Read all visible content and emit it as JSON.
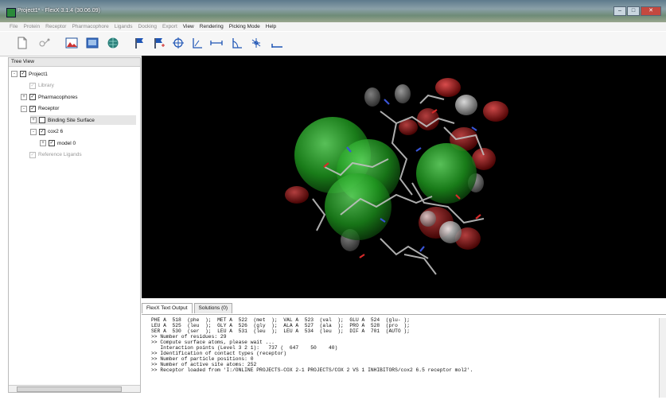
{
  "window": {
    "title": "Project1* - FlexX 3.1.4  (30.06.09)"
  },
  "menu": [
    {
      "label": "File",
      "enabled": false
    },
    {
      "label": "Protein",
      "enabled": false
    },
    {
      "label": "Receptor",
      "enabled": false
    },
    {
      "label": "Pharmacophore",
      "enabled": false
    },
    {
      "label": "Ligands",
      "enabled": false
    },
    {
      "label": "Docking",
      "enabled": false
    },
    {
      "label": "Export",
      "enabled": false
    },
    {
      "label": "View",
      "enabled": true
    },
    {
      "label": "Rendering",
      "enabled": true
    },
    {
      "label": "Picking Mode",
      "enabled": true
    },
    {
      "label": "Help",
      "enabled": true
    }
  ],
  "toolbar_icons": [
    "new-file-icon",
    "ligand-icon",
    "mountain-icon",
    "image-icon",
    "globe-icon",
    "flag-icon",
    "flag-plus-icon",
    "crosshair-icon",
    "axes-icon",
    "distance-icon",
    "angle-icon",
    "dihedral-icon",
    "measure-icon"
  ],
  "tree": {
    "title": "Tree View",
    "items": [
      {
        "label": "Project1",
        "checked": true,
        "expander": "-",
        "dim": false
      },
      {
        "label": "Library",
        "checked": true,
        "expander": "",
        "dim": true
      },
      {
        "label": "Pharmacophores",
        "checked": true,
        "expander": "+",
        "dim": false
      },
      {
        "label": "Receptor",
        "checked": true,
        "expander": "-",
        "dim": false
      },
      {
        "label": "Binding Site Surface",
        "checked": false,
        "expander": "+",
        "dim": false,
        "selected": true
      },
      {
        "label": "cox2 6",
        "checked": true,
        "expander": "-",
        "dim": false
      },
      {
        "label": "model 0",
        "checked": true,
        "expander": "+",
        "dim": false
      },
      {
        "label": "Reference Ligands",
        "checked": true,
        "expander": "",
        "dim": true
      }
    ]
  },
  "tabs": [
    {
      "label": "FlexX Text Output",
      "active": true
    },
    {
      "label": "Solutions (0)",
      "active": false
    }
  ],
  "output_lines": [
    "PHE A  518  (phe  );  MET A  522  (met  );  VAL A  523  (val  );  GLU A  524  (glu- );",
    "LEU A  525  (leu  );  GLY A  526  (gly  );  ALA A  527  (ala  );  PRO A  528  (pro  );",
    "SER A  530  (ser  );  LEU A  531  (leu  );  LEU A  534  (leu  );  DIF A  701  (AUTO );",
    ">> Number of residues: 29",
    ">> Compute surface atoms, please wait ...",
    "   Interaction points (Level 3 2 1):   737 (  647    50    40)",
    ">> Identification of contact types (receptor)",
    ">> Number of particle positions: 0",
    ">> Number of active site atoms: 252",
    ">> Receptor loaded from 'I:/ONLINE PROJECTS-COX 2-1 PROJECTS/COX 2 VS 1 INHIBITORS/cox2 6.5 receptor mol2'."
  ]
}
